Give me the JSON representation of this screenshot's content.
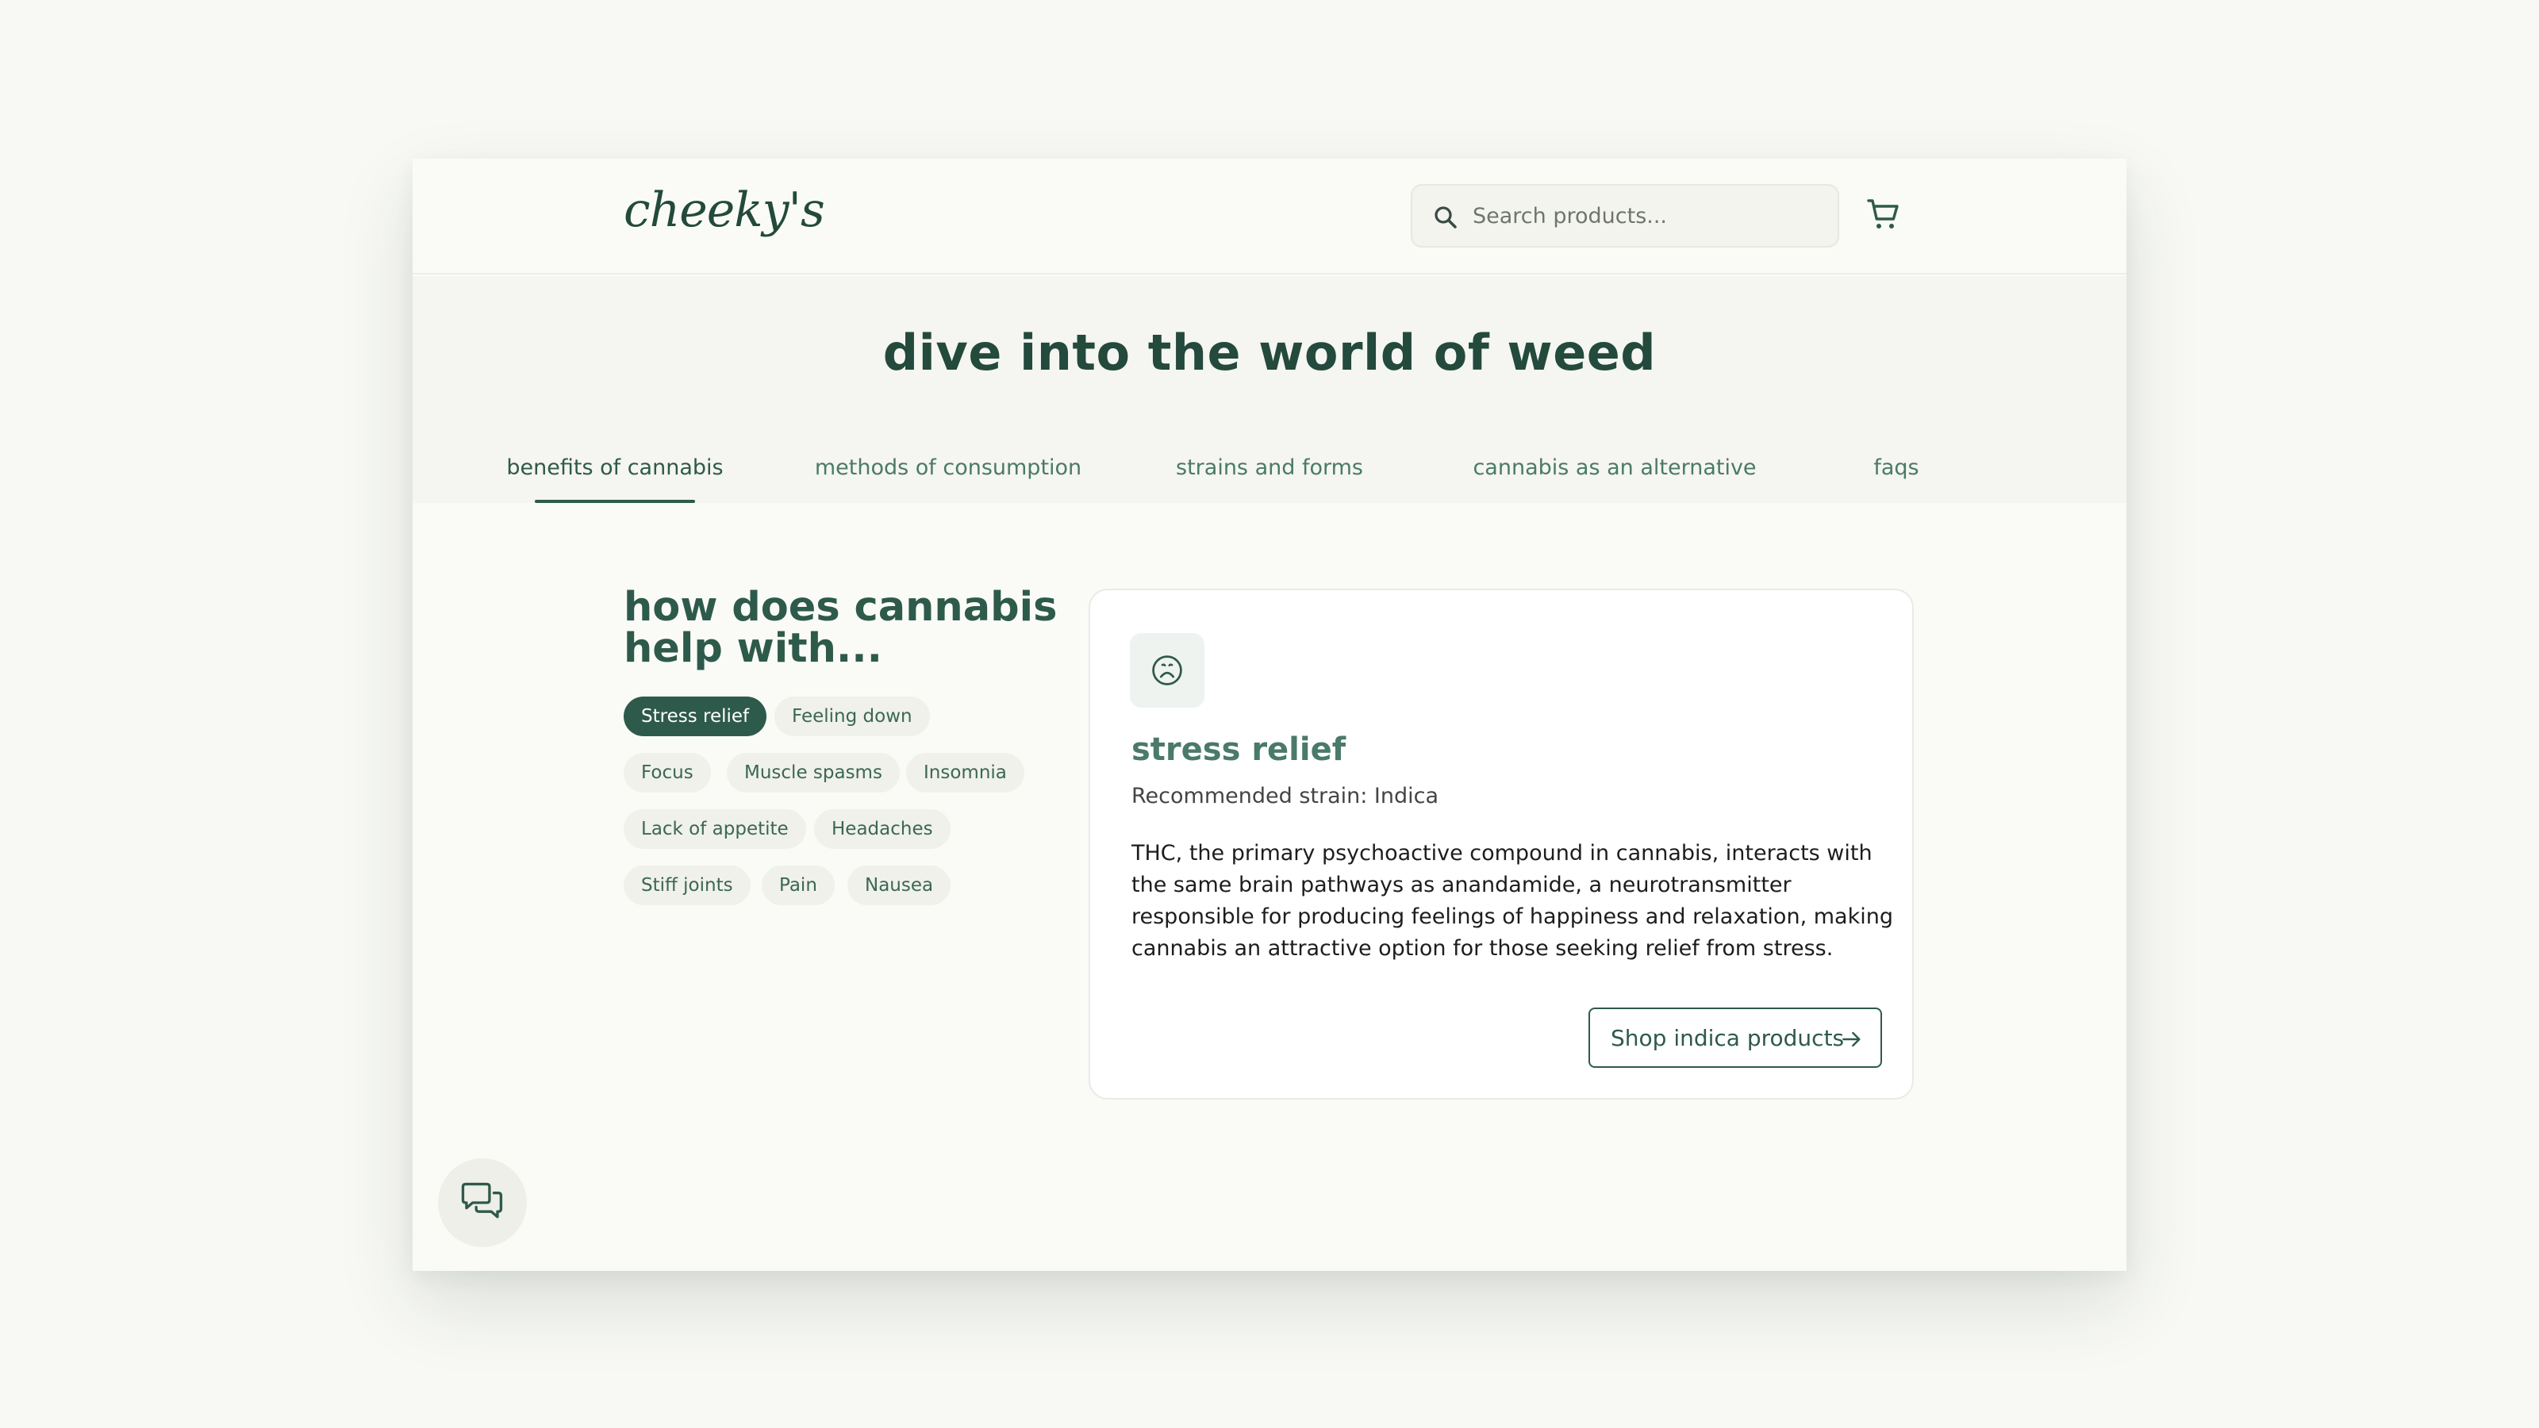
{
  "header": {
    "logo": "cheeky's",
    "search_placeholder": "Search products..."
  },
  "hero": {
    "title": "dive into the world of weed",
    "tabs": [
      {
        "label": "benefits of cannabis",
        "active": true
      },
      {
        "label": "methods of consumption",
        "active": false
      },
      {
        "label": "strains and forms",
        "active": false
      },
      {
        "label": "cannabis as an alternative",
        "active": false
      },
      {
        "label": "faqs",
        "active": false
      }
    ]
  },
  "section": {
    "heading": "how does cannabis help with...",
    "chips": [
      {
        "label": "Stress relief",
        "active": true
      },
      {
        "label": "Feeling down",
        "active": false
      },
      {
        "label": "Focus",
        "active": false
      },
      {
        "label": "Muscle spasms",
        "active": false
      },
      {
        "label": "Insomnia",
        "active": false
      },
      {
        "label": "Lack of appetite",
        "active": false
      },
      {
        "label": "Headaches",
        "active": false
      },
      {
        "label": "Stiff joints",
        "active": false
      },
      {
        "label": "Pain",
        "active": false
      },
      {
        "label": "Nausea",
        "active": false
      }
    ]
  },
  "card": {
    "icon": "frown-face-icon",
    "title": "stress relief",
    "subtitle": "Recommended strain: Indica",
    "body": "THC, the primary psychoactive compound in cannabis, interacts with the same brain pathways as anandamide, a neurotransmitter responsible for producing feelings of happiness and relaxation, making cannabis an attractive option for those seeking relief from stress.",
    "button_label": "Shop indica products"
  },
  "icons": {
    "search": "search-icon",
    "cart": "cart-icon",
    "chat": "chat-bubbles-icon",
    "arrow": "arrow-right-icon"
  },
  "colors": {
    "primary": "#2e5a4b",
    "page_background": "#f8f9f5",
    "hero_background": "#f5f5f1",
    "chip_background": "#eff1ea"
  }
}
